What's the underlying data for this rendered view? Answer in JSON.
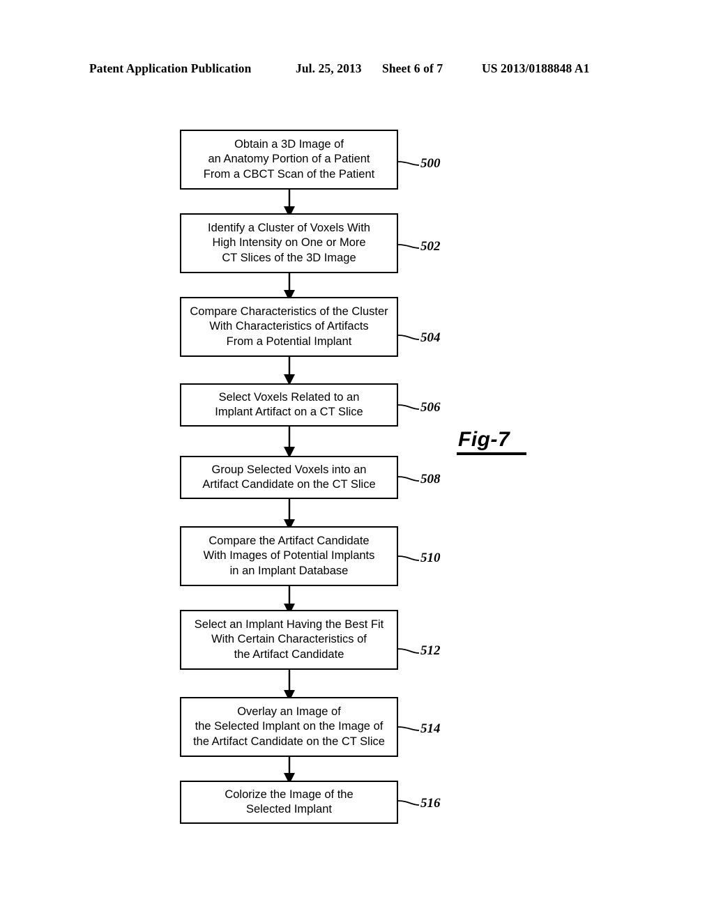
{
  "header": {
    "publication": "Patent Application Publication",
    "date": "Jul. 25, 2013",
    "sheet": "Sheet 6 of 7",
    "patent_number": "US 2013/0188848 A1"
  },
  "figure": {
    "label": "Fig-7"
  },
  "flowchart": {
    "steps": [
      {
        "ref": "500",
        "lines": [
          "Obtain a 3D Image of",
          "an Anatomy Portion of a Patient",
          "From a CBCT Scan of the Patient"
        ]
      },
      {
        "ref": "502",
        "lines": [
          "Identify  a Cluster of Voxels With",
          "High Intensity on One or More",
          "CT Slices of the 3D Image"
        ]
      },
      {
        "ref": "504",
        "lines": [
          "Compare Characteristics of the Cluster",
          "With Characteristics of Artifacts",
          "From a Potential Implant"
        ]
      },
      {
        "ref": "506",
        "lines": [
          "Select Voxels Related to an",
          "Implant Artifact on a CT Slice"
        ]
      },
      {
        "ref": "508",
        "lines": [
          "Group Selected Voxels into an",
          "Artifact Candidate on the CT Slice"
        ]
      },
      {
        "ref": "510",
        "lines": [
          "Compare the Artifact Candidate",
          "With Images of Potential Implants",
          "in an Implant Database"
        ]
      },
      {
        "ref": "512",
        "lines": [
          "Select an Implant Having the Best Fit",
          "With Certain Characteristics of",
          "the Artifact Candidate"
        ]
      },
      {
        "ref": "514",
        "lines": [
          "Overlay an Image of",
          "the Selected Implant on the Image of",
          "the Artifact Candidate on the CT Slice"
        ]
      },
      {
        "ref": "516",
        "lines": [
          "Colorize the Image of the",
          "Selected Implant"
        ]
      }
    ]
  },
  "colors": {
    "ink": "#000000",
    "paper": "#ffffff"
  }
}
